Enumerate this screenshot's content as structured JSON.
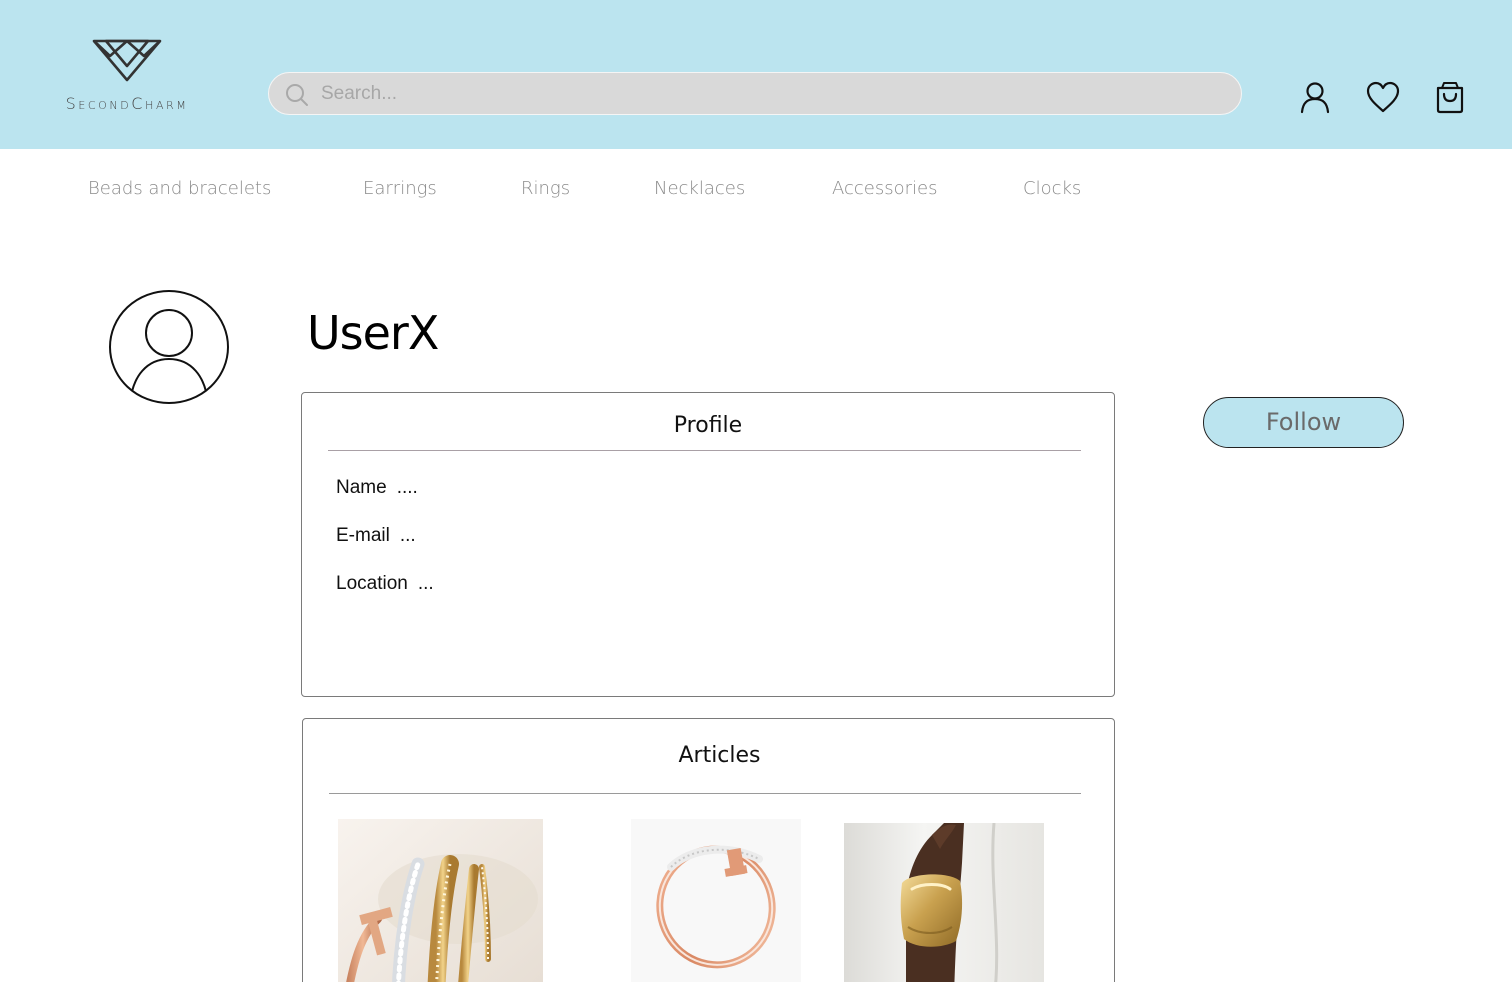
{
  "brand": {
    "name": "SecondCharm"
  },
  "search": {
    "placeholder": "Search..."
  },
  "header_icons": [
    "user-icon",
    "heart-icon",
    "shopping-bag-icon"
  ],
  "nav": {
    "items": [
      "Beads and bracelets",
      "Earrings",
      "Rings",
      "Necklaces",
      "Accessories",
      "Clocks"
    ]
  },
  "user": {
    "name": "UserX"
  },
  "follow_label": "Follow",
  "profile": {
    "title": "Profile",
    "fields": [
      {
        "label": "Name",
        "value": "...."
      },
      {
        "label": "E-mail",
        "value": "..."
      },
      {
        "label": "Location",
        "value": "..."
      }
    ]
  },
  "articles": {
    "title": "Articles",
    "items": [
      {
        "image": "stacked-rings-bracelets"
      },
      {
        "image": "rose-gold-t-bracelet"
      },
      {
        "image": "gold-cuff-on-wrist"
      }
    ]
  },
  "colors": {
    "header_bg": "#bbe4ef",
    "search_bg": "#d9d9d9",
    "accent": "#bbe4ef"
  }
}
